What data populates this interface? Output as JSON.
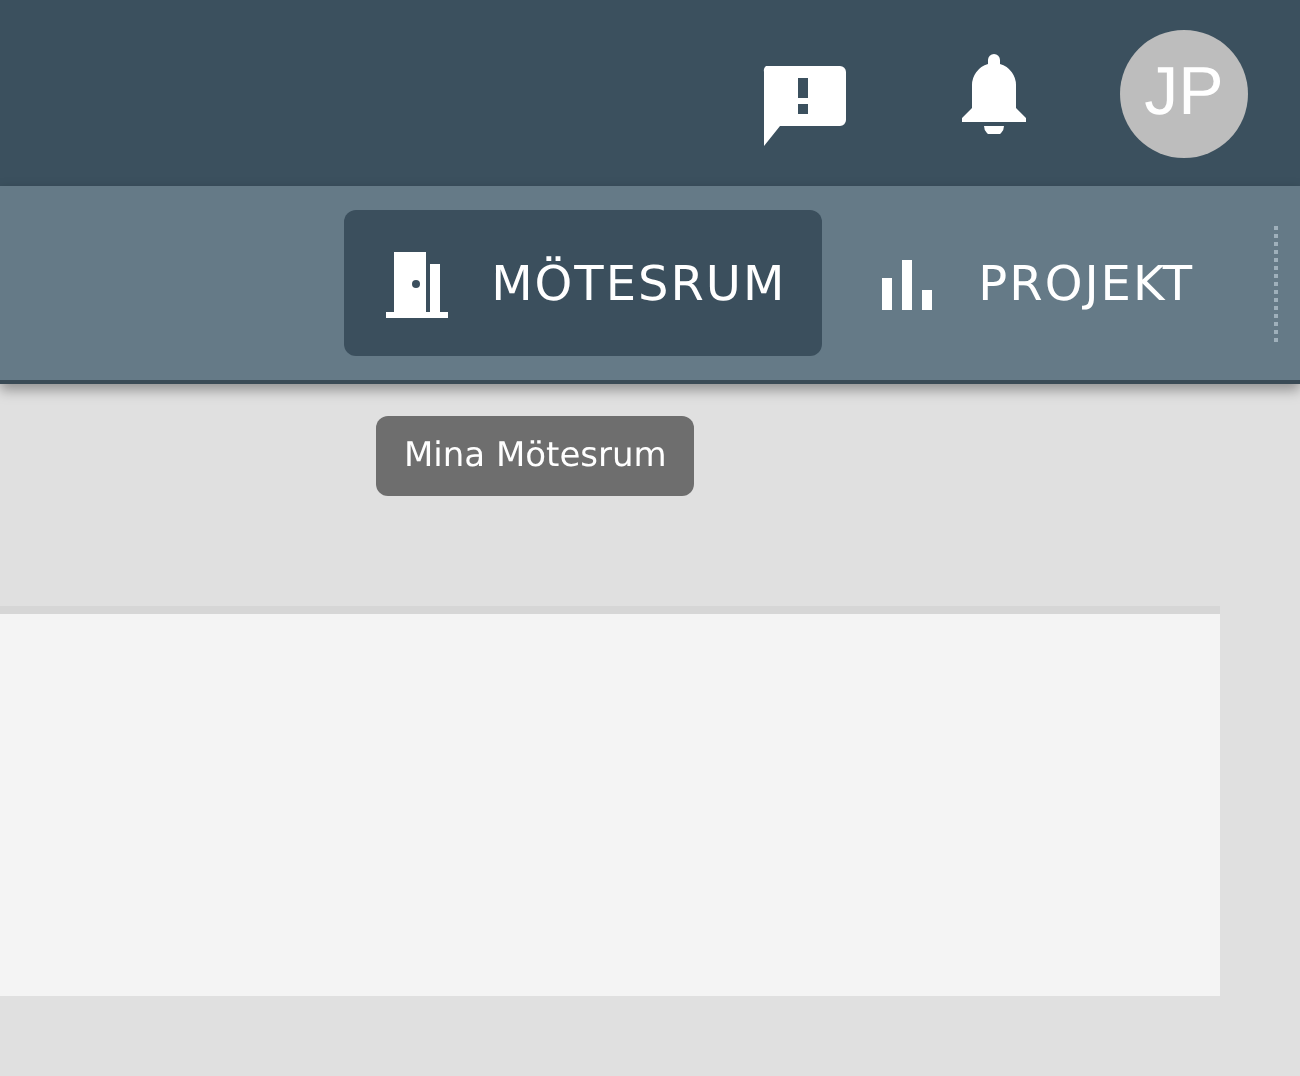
{
  "top_bar": {
    "avatar": {
      "initials": "JP"
    }
  },
  "tabs": [
    {
      "label": "MÖTESRUM",
      "kind": "rooms",
      "selected": true
    },
    {
      "label": "PROJEKT",
      "kind": "projects",
      "selected": false
    }
  ],
  "tooltip": {
    "text": "Mina Mötesrum"
  }
}
